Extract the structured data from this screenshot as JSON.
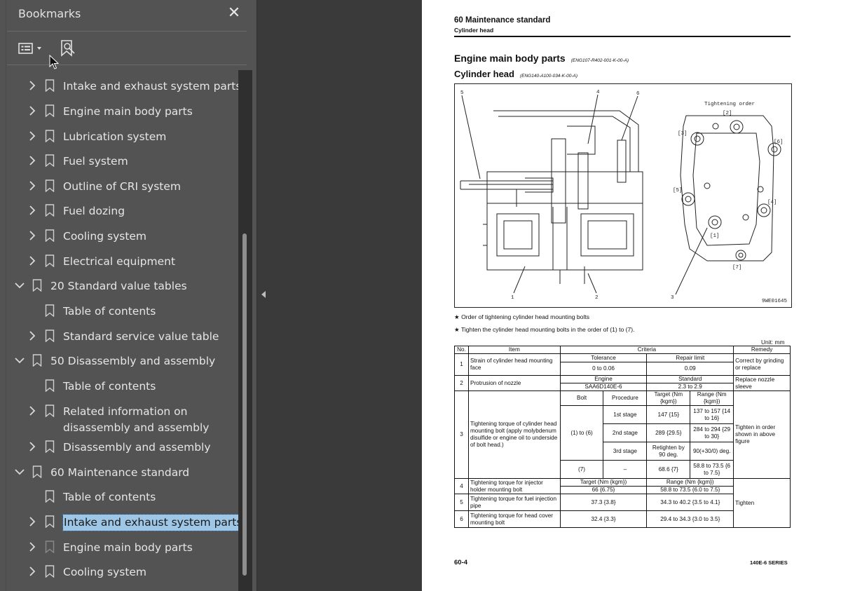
{
  "sidebar": {
    "title": "Bookmarks",
    "close_icon": "close-icon",
    "tools": [
      "options-menu-icon",
      "find-bookmark-icon"
    ],
    "items": [
      {
        "label": "Intake and exhaust system parts",
        "level": 1,
        "chevron": "right"
      },
      {
        "label": "Engine main body parts",
        "level": 1,
        "chevron": "right"
      },
      {
        "label": "Lubrication system",
        "level": 1,
        "chevron": "right"
      },
      {
        "label": "Fuel system",
        "level": 1,
        "chevron": "right"
      },
      {
        "label": "Outline of CRI system",
        "level": 1,
        "chevron": "right"
      },
      {
        "label": "Fuel dozing",
        "level": 1,
        "chevron": "right"
      },
      {
        "label": "Cooling system",
        "level": 1,
        "chevron": "right"
      },
      {
        "label": "Electrical equipment",
        "level": 1,
        "chevron": "right"
      },
      {
        "label": "20 Standard value tables",
        "level": 0,
        "chevron": "down"
      },
      {
        "label": "Table of contents",
        "level": 1,
        "chevron": "none"
      },
      {
        "label": "Standard service value table",
        "level": 1,
        "chevron": "right"
      },
      {
        "label": "50 Disassembly and assembly",
        "level": 0,
        "chevron": "down"
      },
      {
        "label": "Table of contents",
        "level": 1,
        "chevron": "none"
      },
      {
        "label": "Related information on",
        "label2": "disassembly and assembly",
        "level": 1,
        "chevron": "right"
      },
      {
        "label": "Disassembly and assembly",
        "level": 1,
        "chevron": "right"
      },
      {
        "label": "60 Maintenance standard",
        "level": 0,
        "chevron": "down"
      },
      {
        "label": "Table of contents",
        "level": 1,
        "chevron": "none"
      },
      {
        "label": "Intake and exhaust system parts",
        "level": 1,
        "chevron": "right",
        "selected": true
      },
      {
        "label": "Engine main body parts",
        "level": 1,
        "chevron": "right"
      },
      {
        "label": "Cooling system",
        "level": 1,
        "chevron": "right"
      }
    ]
  },
  "document": {
    "header_title": "60 Maintenance standard",
    "header_subtitle": "Cylinder head",
    "section1": "Engine main body parts",
    "section1_code": "(ENG107-R402-001-K-00-A)",
    "section2": "Cylinder head",
    "section2_code": "(ENG140-A100-034-K-00-A)",
    "figure": {
      "tightening_label": "Tightening order",
      "figure_code": "9WE01645",
      "callouts": [
        "1",
        "2",
        "3",
        "4",
        "5",
        "6"
      ],
      "order_marks": [
        "[1]",
        "[2]",
        "[3]",
        "[4]",
        "[5]",
        "[6]",
        "[7]"
      ]
    },
    "notes": [
      "★  Order of tightening cylinder head mounting bolts",
      "★  Tighten the cylinder head mounting bolts in the order of (1) to (7)."
    ],
    "unit": "Unit: mm",
    "table": {
      "h_no": "No.",
      "h_item": "Item",
      "h_criteria": "Criteria",
      "h_remedy": "Remedy",
      "r1": {
        "no": "1",
        "item": "Strain of cylinder head mounting face",
        "tol_h": "Tolerance",
        "rep_h": "Repair limit",
        "tol": "0 to 0.06",
        "rep": "0.09",
        "remedy": "Correct by grinding or replace"
      },
      "r2": {
        "no": "2",
        "item": "Protrusion of nozzle",
        "eng_h": "Engine",
        "std_h": "Standard",
        "eng": "SAA6D140E-6",
        "std": "2.3 to 2.9",
        "remedy": "Replace nozzle sleeve"
      },
      "r3": {
        "no": "3",
        "item": "Tightening torque of cylinder head mounting bolt (apply molybdenum disulfide or engine oil to underside of bolt head.)",
        "bolt_h": "Bolt",
        "proc_h": "Procedure",
        "target_h": "Target (Nm {kgm})",
        "range_h": "Range (Nm {kgm})",
        "bolts16": "(1) to (6)",
        "stage1": "1st stage",
        "stage2": "2nd stage",
        "stage3": "3rd stage",
        "t1": "147 {15}",
        "r1": "137 to 157 {14 to 16}",
        "t2": "289 {29.5}",
        "r2": "284 to 294 {29 to 30}",
        "t3": "Retighten by 90 deg.",
        "r3": "90(+30/0) deg.",
        "bolt7": "(7)",
        "dash": "–",
        "t7": "68.6 {7}",
        "r7": "58.8 to 73.5 {6 to 7.5}",
        "remedy": "Tighten in order shown in above figure"
      },
      "r4": {
        "no": "4",
        "item": "Tightening torque for injector holder mounting bolt",
        "target_h": "Target (Nm {kgm})",
        "range_h": "Range (Nm {kgm})",
        "target": "66 {6.75}",
        "range": "58.8 to 73.5 {6.0 to 7.5}"
      },
      "r5": {
        "no": "5",
        "item": "Tightening torque for fuel injection pipe",
        "target": "37.3 {3.8}",
        "range": "34.3 to 40.2 {3.5 to 4.1}",
        "remedy": "Tighten"
      },
      "r6": {
        "no": "6",
        "item": "Tightening torque for head cover mounting bolt",
        "target": "32.4 {3.3}",
        "range": "29.4 to 34.3 {3.0 to 3.5}"
      }
    },
    "footer_left": "60-4",
    "footer_right": "140E-6 SERIES"
  }
}
